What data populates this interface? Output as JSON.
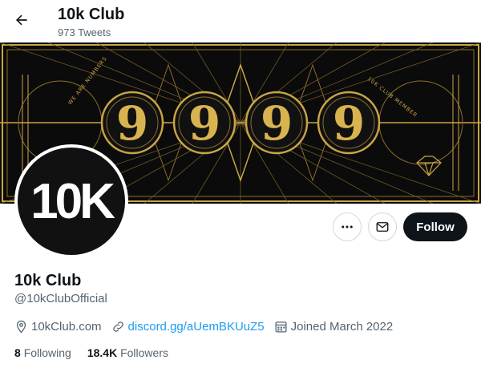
{
  "header": {
    "title": "10k Club",
    "tweet_count": "973 Tweets",
    "back_icon": "arrow-left-icon"
  },
  "banner": {
    "digits": [
      "9",
      "9",
      "9",
      "9"
    ],
    "left_arc_text": "WE ARE NUMBERS",
    "right_arc_text": "10K CLUB MEMBER",
    "colors": {
      "background": "#0b0b0b",
      "gold": "#c9a545"
    }
  },
  "avatar": {
    "text": "10K"
  },
  "actions": {
    "more_icon": "more-horizontal-icon",
    "message_icon": "envelope-icon",
    "follow_label": "Follow"
  },
  "profile": {
    "name": "10k Club",
    "handle": "@10kClubOfficial",
    "location": "10kClub.com",
    "link": "discord.gg/aUemBKUuZ5",
    "joined": "Joined March 2022"
  },
  "stats": {
    "following_count": "8",
    "following_label": "Following",
    "followers_count": "18.4K",
    "followers_label": "Followers"
  },
  "colors": {
    "accent": "#1d9bf0",
    "text": "#0f1419",
    "muted": "#536471"
  }
}
